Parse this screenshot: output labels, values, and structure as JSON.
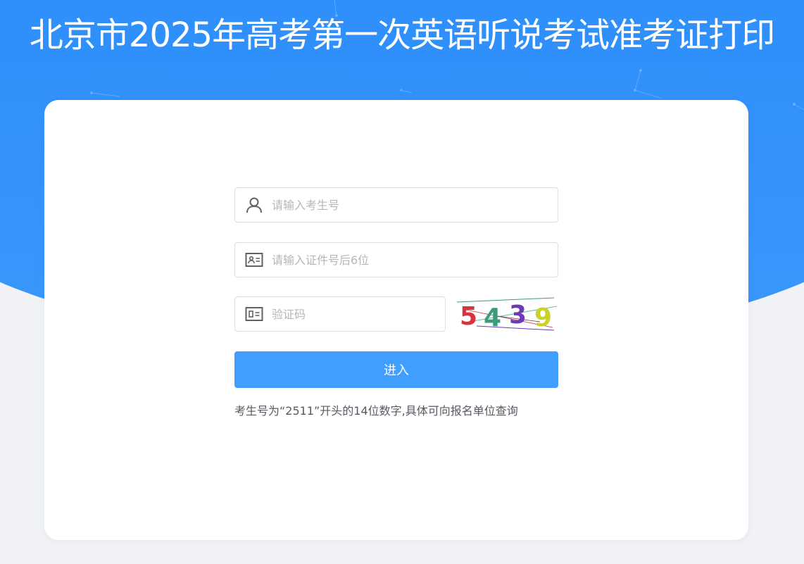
{
  "header": {
    "title": "北京市2025年高考第一次英语听说考试准考证打印"
  },
  "form": {
    "exam_number": {
      "placeholder": "请输入考生号",
      "value": "",
      "icon": "user-icon"
    },
    "id_last6": {
      "placeholder": "请输入证件号后6位",
      "value": "",
      "icon": "id-card-icon"
    },
    "captcha_input": {
      "placeholder": "验证码",
      "value": "",
      "icon": "captcha-card-icon"
    },
    "captcha_image": {
      "digits": [
        "5",
        "4",
        "3",
        "9"
      ],
      "colors": [
        "#d8353b",
        "#3b9b7a",
        "#6a3bb5",
        "#c9d12a"
      ]
    },
    "submit_label": "进入",
    "hint": "考生号为“2511”开头的14位数字,具体可向报名单位查询"
  },
  "theme": {
    "accent": "#409eff",
    "hero_top": "#1a7cf9",
    "hero_bottom": "#3a97fb",
    "background": "#f1f2f6"
  }
}
